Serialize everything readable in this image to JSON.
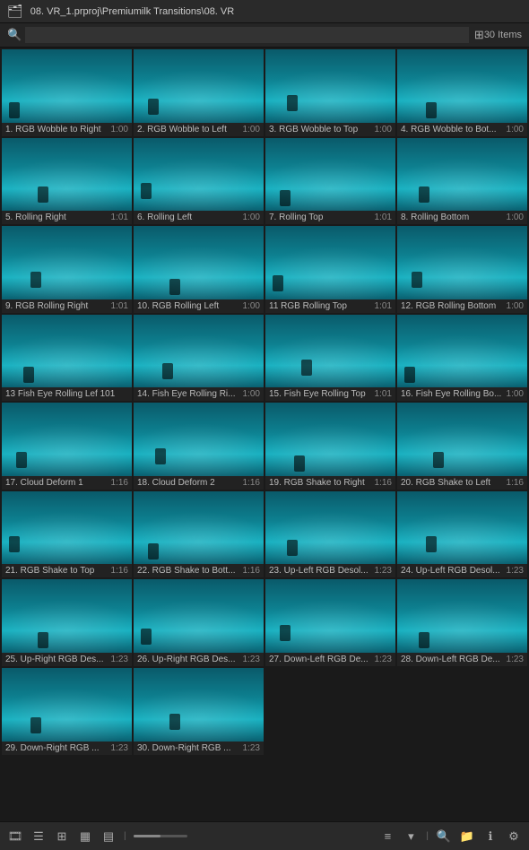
{
  "titleBar": {
    "icon": "folder-icon",
    "path": "08. VR_1.prproj\\Premiumilk Transitions\\08. VR"
  },
  "searchBar": {
    "placeholder": "",
    "searchIconLabel": "search-icon",
    "filterIconLabel": "filter-icon"
  },
  "itemsCount": "30 Items",
  "items": [
    {
      "id": 1,
      "name": "1. RGB Wobble to Right",
      "duration": "1:00",
      "variant": "v1"
    },
    {
      "id": 2,
      "name": "2. RGB Wobble to Left",
      "duration": "1:00",
      "variant": "v2"
    },
    {
      "id": 3,
      "name": "3. RGB Wobble to Top",
      "duration": "1:00",
      "variant": "v3"
    },
    {
      "id": 4,
      "name": "4. RGB Wobble to Bot...",
      "duration": "1:00",
      "variant": "v4"
    },
    {
      "id": 5,
      "name": "5. Rolling Right",
      "duration": "1:01",
      "variant": "v2"
    },
    {
      "id": 6,
      "name": "6. Rolling Left",
      "duration": "1:00",
      "variant": "v1"
    },
    {
      "id": 7,
      "name": "7. Rolling Top",
      "duration": "1:01",
      "variant": "v3"
    },
    {
      "id": 8,
      "name": "8. Rolling Bottom",
      "duration": "1:00",
      "variant": "v4"
    },
    {
      "id": 9,
      "name": "9. RGB Rolling Right",
      "duration": "1:01",
      "variant": "v3"
    },
    {
      "id": 10,
      "name": "10. RGB Rolling Left",
      "duration": "1:00",
      "variant": "v2"
    },
    {
      "id": 11,
      "name": "11 RGB Rolling Top",
      "duration": "1:01",
      "variant": "v1"
    },
    {
      "id": 12,
      "name": "12. RGB Rolling Bottom",
      "duration": "1:00",
      "variant": "v4"
    },
    {
      "id": 13,
      "name": "13 Fish Eye Rolling Lef 101",
      "duration": "",
      "variant": "v2"
    },
    {
      "id": 14,
      "name": "14. Fish Eye Rolling Ri...",
      "duration": "1:00",
      "variant": "v1"
    },
    {
      "id": 15,
      "name": "15. Fish Eye Rolling Top",
      "duration": "1:01",
      "variant": "v3"
    },
    {
      "id": 16,
      "name": "16. Fish Eye Rolling Bo...",
      "duration": "1:00",
      "variant": "v4"
    },
    {
      "id": 17,
      "name": "17. Cloud Deform 1",
      "duration": "1:16",
      "variant": "v1"
    },
    {
      "id": 18,
      "name": "18. Cloud Deform 2",
      "duration": "1:16",
      "variant": "v2"
    },
    {
      "id": 19,
      "name": "19. RGB Shake to Right",
      "duration": "1:16",
      "variant": "v3"
    },
    {
      "id": 20,
      "name": "20. RGB Shake to Left",
      "duration": "1:16",
      "variant": "v4"
    },
    {
      "id": 21,
      "name": "21. RGB Shake to Top",
      "duration": "1:16",
      "variant": "v2"
    },
    {
      "id": 22,
      "name": "22. RGB Shake to Bott...",
      "duration": "1:16",
      "variant": "v1"
    },
    {
      "id": 23,
      "name": "23. Up-Left RGB Desol...",
      "duration": "1:23",
      "variant": "v4"
    },
    {
      "id": 24,
      "name": "24. Up-Left RGB Desol...",
      "duration": "1:23",
      "variant": "v3"
    },
    {
      "id": 25,
      "name": "25. Up-Right RGB Des...",
      "duration": "1:23",
      "variant": "v1"
    },
    {
      "id": 26,
      "name": "26. Up-Right RGB Des...",
      "duration": "1:23",
      "variant": "v2"
    },
    {
      "id": 27,
      "name": "27. Down-Left RGB De...",
      "duration": "1:23",
      "variant": "v3"
    },
    {
      "id": 28,
      "name": "28. Down-Left RGB De...",
      "duration": "1:23",
      "variant": "v4"
    },
    {
      "id": 29,
      "name": "29. Down-Right RGB ...",
      "duration": "1:23",
      "variant": "v1"
    },
    {
      "id": 30,
      "name": "30. Down-Right RGB ...",
      "duration": "1:23",
      "variant": "v2"
    }
  ],
  "bottomToolbar": {
    "icons": [
      "list-icon",
      "grid-small-icon",
      "grid-large-icon",
      "panel-icon",
      "slider-label",
      "menu-icon",
      "dropdown-icon"
    ],
    "searchLabel": "search-icon",
    "mediaLabel": "media-icon",
    "infoLabel": "info-icon",
    "settingsLabel": "settings-icon"
  }
}
